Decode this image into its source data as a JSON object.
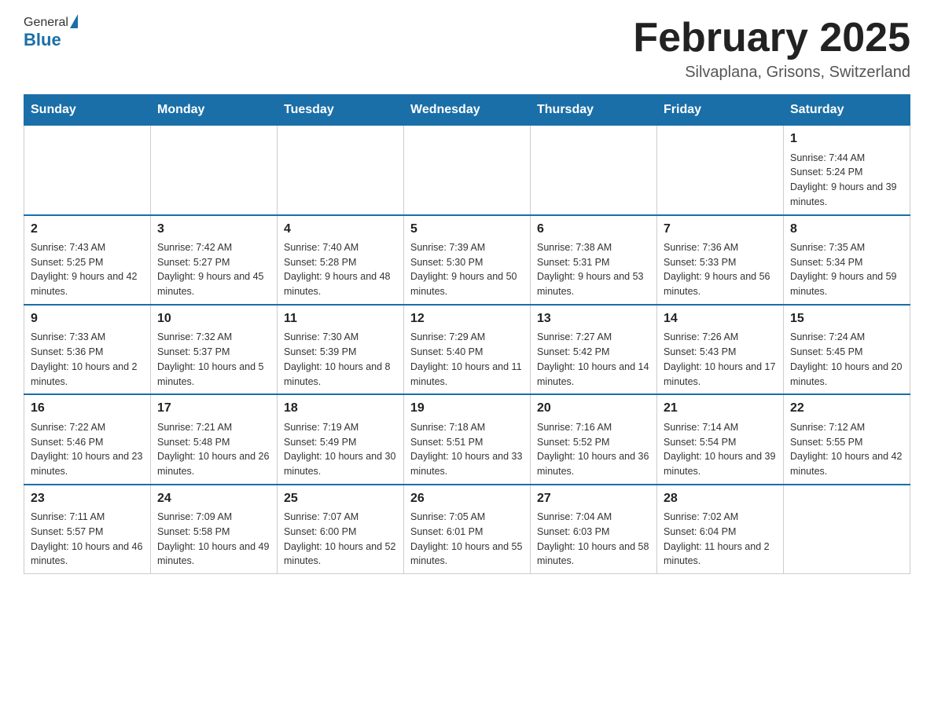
{
  "header": {
    "logo_general": "General",
    "logo_blue": "Blue",
    "title": "February 2025",
    "location": "Silvaplana, Grisons, Switzerland"
  },
  "weekdays": [
    "Sunday",
    "Monday",
    "Tuesday",
    "Wednesday",
    "Thursday",
    "Friday",
    "Saturday"
  ],
  "weeks": [
    [
      {
        "day": "",
        "info": ""
      },
      {
        "day": "",
        "info": ""
      },
      {
        "day": "",
        "info": ""
      },
      {
        "day": "",
        "info": ""
      },
      {
        "day": "",
        "info": ""
      },
      {
        "day": "",
        "info": ""
      },
      {
        "day": "1",
        "info": "Sunrise: 7:44 AM\nSunset: 5:24 PM\nDaylight: 9 hours and 39 minutes."
      }
    ],
    [
      {
        "day": "2",
        "info": "Sunrise: 7:43 AM\nSunset: 5:25 PM\nDaylight: 9 hours and 42 minutes."
      },
      {
        "day": "3",
        "info": "Sunrise: 7:42 AM\nSunset: 5:27 PM\nDaylight: 9 hours and 45 minutes."
      },
      {
        "day": "4",
        "info": "Sunrise: 7:40 AM\nSunset: 5:28 PM\nDaylight: 9 hours and 48 minutes."
      },
      {
        "day": "5",
        "info": "Sunrise: 7:39 AM\nSunset: 5:30 PM\nDaylight: 9 hours and 50 minutes."
      },
      {
        "day": "6",
        "info": "Sunrise: 7:38 AM\nSunset: 5:31 PM\nDaylight: 9 hours and 53 minutes."
      },
      {
        "day": "7",
        "info": "Sunrise: 7:36 AM\nSunset: 5:33 PM\nDaylight: 9 hours and 56 minutes."
      },
      {
        "day": "8",
        "info": "Sunrise: 7:35 AM\nSunset: 5:34 PM\nDaylight: 9 hours and 59 minutes."
      }
    ],
    [
      {
        "day": "9",
        "info": "Sunrise: 7:33 AM\nSunset: 5:36 PM\nDaylight: 10 hours and 2 minutes."
      },
      {
        "day": "10",
        "info": "Sunrise: 7:32 AM\nSunset: 5:37 PM\nDaylight: 10 hours and 5 minutes."
      },
      {
        "day": "11",
        "info": "Sunrise: 7:30 AM\nSunset: 5:39 PM\nDaylight: 10 hours and 8 minutes."
      },
      {
        "day": "12",
        "info": "Sunrise: 7:29 AM\nSunset: 5:40 PM\nDaylight: 10 hours and 11 minutes."
      },
      {
        "day": "13",
        "info": "Sunrise: 7:27 AM\nSunset: 5:42 PM\nDaylight: 10 hours and 14 minutes."
      },
      {
        "day": "14",
        "info": "Sunrise: 7:26 AM\nSunset: 5:43 PM\nDaylight: 10 hours and 17 minutes."
      },
      {
        "day": "15",
        "info": "Sunrise: 7:24 AM\nSunset: 5:45 PM\nDaylight: 10 hours and 20 minutes."
      }
    ],
    [
      {
        "day": "16",
        "info": "Sunrise: 7:22 AM\nSunset: 5:46 PM\nDaylight: 10 hours and 23 minutes."
      },
      {
        "day": "17",
        "info": "Sunrise: 7:21 AM\nSunset: 5:48 PM\nDaylight: 10 hours and 26 minutes."
      },
      {
        "day": "18",
        "info": "Sunrise: 7:19 AM\nSunset: 5:49 PM\nDaylight: 10 hours and 30 minutes."
      },
      {
        "day": "19",
        "info": "Sunrise: 7:18 AM\nSunset: 5:51 PM\nDaylight: 10 hours and 33 minutes."
      },
      {
        "day": "20",
        "info": "Sunrise: 7:16 AM\nSunset: 5:52 PM\nDaylight: 10 hours and 36 minutes."
      },
      {
        "day": "21",
        "info": "Sunrise: 7:14 AM\nSunset: 5:54 PM\nDaylight: 10 hours and 39 minutes."
      },
      {
        "day": "22",
        "info": "Sunrise: 7:12 AM\nSunset: 5:55 PM\nDaylight: 10 hours and 42 minutes."
      }
    ],
    [
      {
        "day": "23",
        "info": "Sunrise: 7:11 AM\nSunset: 5:57 PM\nDaylight: 10 hours and 46 minutes."
      },
      {
        "day": "24",
        "info": "Sunrise: 7:09 AM\nSunset: 5:58 PM\nDaylight: 10 hours and 49 minutes."
      },
      {
        "day": "25",
        "info": "Sunrise: 7:07 AM\nSunset: 6:00 PM\nDaylight: 10 hours and 52 minutes."
      },
      {
        "day": "26",
        "info": "Sunrise: 7:05 AM\nSunset: 6:01 PM\nDaylight: 10 hours and 55 minutes."
      },
      {
        "day": "27",
        "info": "Sunrise: 7:04 AM\nSunset: 6:03 PM\nDaylight: 10 hours and 58 minutes."
      },
      {
        "day": "28",
        "info": "Sunrise: 7:02 AM\nSunset: 6:04 PM\nDaylight: 11 hours and 2 minutes."
      },
      {
        "day": "",
        "info": ""
      }
    ]
  ]
}
